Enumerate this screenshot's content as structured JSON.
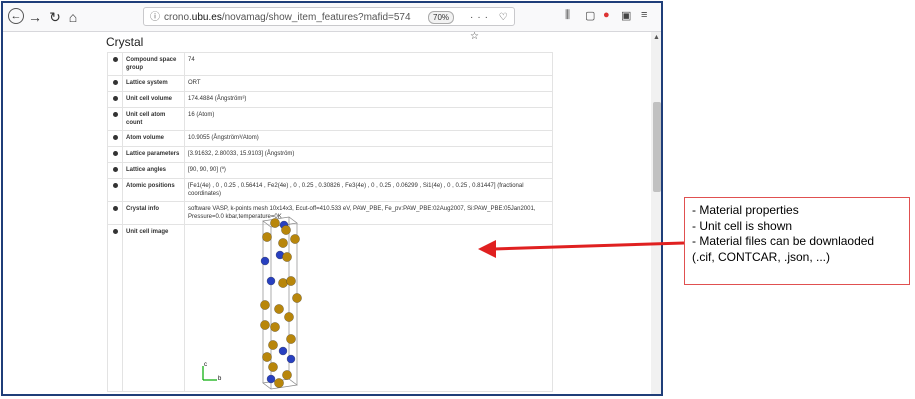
{
  "browser": {
    "url_prefix": "crono.",
    "url_domain": "ubu.es",
    "url_path": "/novamag/show_item_features?mafid=574",
    "zoom": "70%",
    "url_icons": "··· ♡ ☆",
    "right_icons": "\\ ▢ ● ▣ ≡"
  },
  "page": {
    "section_title": "Crystal",
    "rows": [
      {
        "label": "Compound space group",
        "value": "74"
      },
      {
        "label": "Lattice system",
        "value": "ORT"
      },
      {
        "label": "Unit cell volume",
        "value": "174.4884 (Ångström³)"
      },
      {
        "label": "Unit cell atom count",
        "value": "16 (Atom)"
      },
      {
        "label": "Atom volume",
        "value": "10.9055 (Ångström³/Atom)"
      },
      {
        "label": "Lattice parameters",
        "value": "[3.91632, 2.80033, 15.9103] (Ångström)"
      },
      {
        "label": "Lattice angles",
        "value": "[90, 90, 90] (º)"
      },
      {
        "label": "Atomic positions",
        "value": "[Fe1(4e) , 0 , 0.25 , 0.56414 , Fe2(4e) , 0 , 0.25 , 0.30826 , Fe3(4e) , 0 , 0.25 , 0.06299 , Si1(4e) , 0 , 0.25 , 0.81447] (fractional coordinates)"
      },
      {
        "label": "Crystal info",
        "value": "software VASP, k-points mesh 10x14x3, Ecut-off=410.533 eV, PAW_PBE, Fe_pv:PAW_PBE:02Aug2007, Si:PAW_PBE:05Jan2001, Pressure=0.0 kbar,temperature=0K"
      },
      {
        "label": "Unit cell image",
        "value": ""
      }
    ],
    "axis": {
      "c": "c",
      "b": "b"
    }
  },
  "annotation": {
    "lines": [
      "- Material properties",
      "- Unit cell is shown",
      "- Material files can be downlaoded",
      "(.cif, CONTCAR, .json, ...)"
    ]
  },
  "colors": {
    "frame": "#1f3e79",
    "arrow": "#e02020",
    "fe_atom": "#b8860b",
    "si_atom": "#2840c0"
  }
}
